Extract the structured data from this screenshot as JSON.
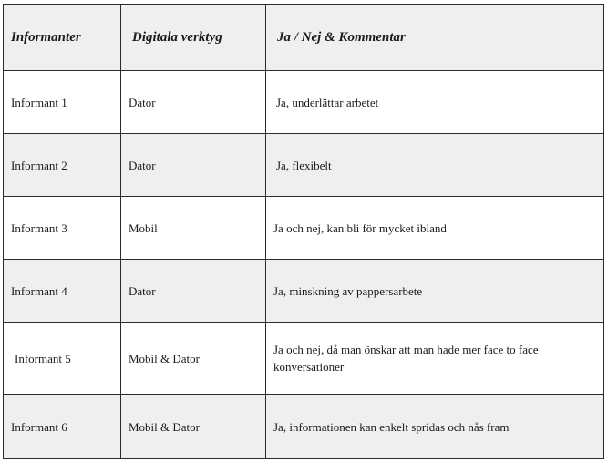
{
  "table": {
    "headers": [
      "Informanter",
      "Digitala verktyg",
      "Ja / Nej & Kommentar"
    ],
    "rows": [
      {
        "informant": "Informant 1",
        "tool": "Dator",
        "comment": "Ja, underlättar arbetet"
      },
      {
        "informant": "Informant 2",
        "tool": "Dator",
        "comment": "Ja, flexibelt"
      },
      {
        "informant": "Informant 3",
        "tool": "Mobil",
        "comment": "Ja och nej, kan bli för mycket ibland"
      },
      {
        "informant": "Informant 4",
        "tool": "Dator",
        "comment": "Ja, minskning av pappersarbete"
      },
      {
        "informant": "Informant 5",
        "tool": "Mobil & Dator",
        "comment": "Ja och nej, då man önskar att man hade mer face to face konversationer"
      },
      {
        "informant": "Informant 6",
        "tool": "Mobil & Dator",
        "comment": "Ja, informationen kan enkelt spridas och nås fram"
      }
    ]
  },
  "colors": {
    "shaded_row": "#efefef",
    "plain_row": "#ffffff",
    "border": "#2b2b2b"
  }
}
